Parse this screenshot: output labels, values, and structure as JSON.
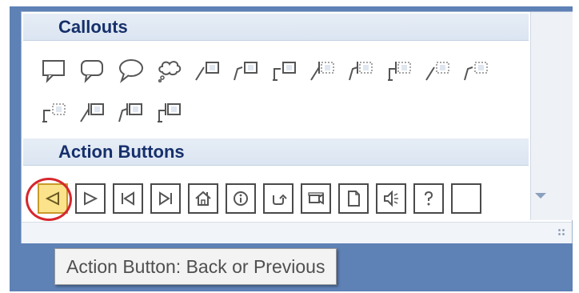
{
  "sections": {
    "callouts_label": "Callouts",
    "action_buttons_label": "Action Buttons"
  },
  "callout_shapes": [
    "rectangular-callout-icon",
    "rounded-rectangular-callout-icon",
    "oval-callout-icon",
    "cloud-callout-icon",
    "line-callout-1-icon",
    "line-callout-2-icon",
    "line-callout-3-icon",
    "line-callout-1-accent-bar-icon",
    "line-callout-2-accent-bar-icon",
    "line-callout-3-accent-bar-icon",
    "line-callout-1-no-border-icon",
    "line-callout-2-no-border-icon",
    "line-callout-3-no-border-icon",
    "line-callout-1-border-accent-bar-icon",
    "line-callout-2-border-accent-bar-icon",
    "line-callout-3-border-accent-bar-icon"
  ],
  "action_buttons": [
    "action-back-previous-icon",
    "action-forward-next-icon",
    "action-beginning-icon",
    "action-end-icon",
    "action-home-icon",
    "action-information-icon",
    "action-return-icon",
    "action-movie-icon",
    "action-document-icon",
    "action-sound-icon",
    "action-help-icon",
    "action-custom-icon"
  ],
  "selected_action_index": 0,
  "tooltip": {
    "text": "Action Button: Back or Previous"
  },
  "colors": {
    "header_text": "#16306b",
    "selected_fill": "#fbe38c",
    "highlight_ring": "#d6282d",
    "frame_blue": "#5e81b6"
  }
}
